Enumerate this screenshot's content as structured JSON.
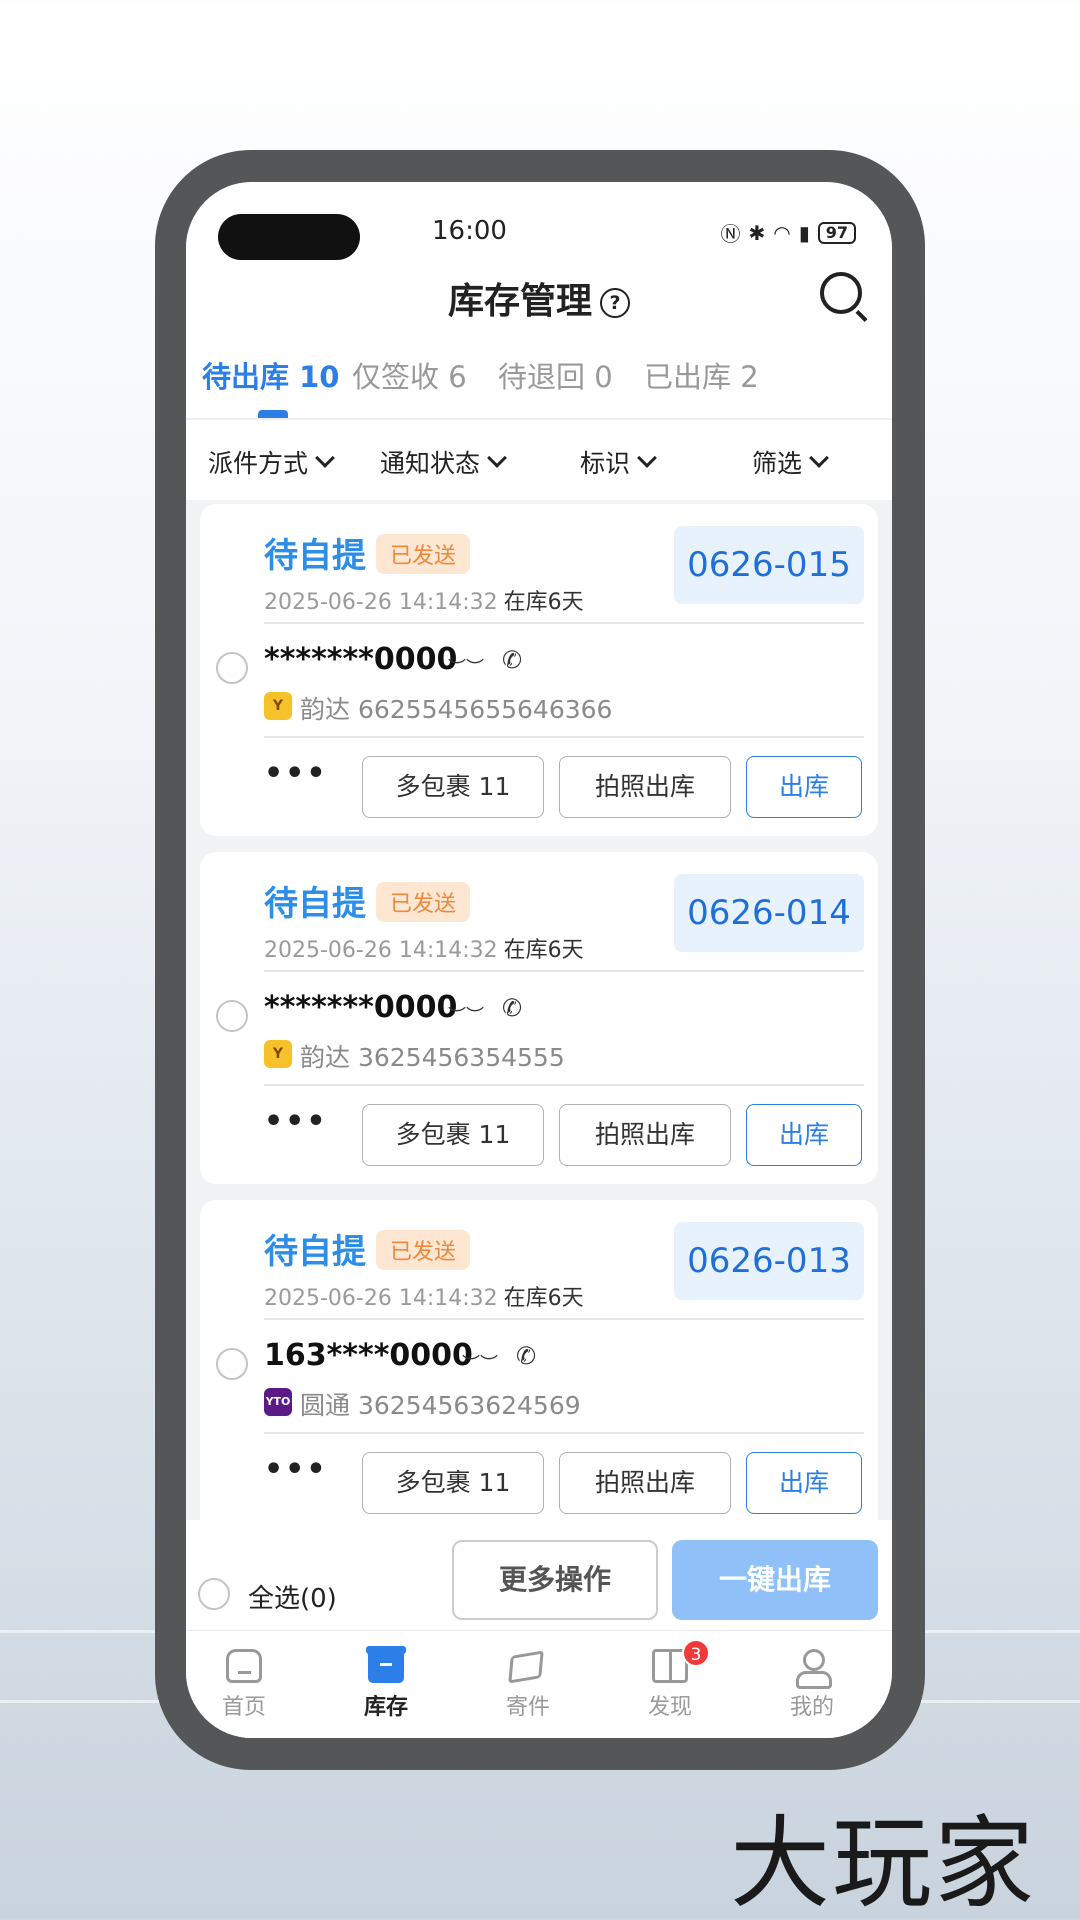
{
  "status_bar": {
    "time": "16:00",
    "battery": "97"
  },
  "header": {
    "title": "库存管理",
    "help_glyph": "?"
  },
  "tabs": [
    {
      "label": "待出库 10",
      "active": true
    },
    {
      "label": "仅签收 6",
      "active": false
    },
    {
      "label": "待退回 0",
      "active": false
    },
    {
      "label": "已出库 2",
      "active": false
    }
  ],
  "filters": [
    "派件方式",
    "通知状态",
    "标识",
    "筛选"
  ],
  "cards": [
    {
      "status": "待自提",
      "tag": "已发送",
      "time": "2025-06-26 14:14:32",
      "days": "在库6天",
      "code": "0626-015",
      "phone": "*******0000",
      "carrier": "韵达",
      "tracking": "6625545655646366",
      "more": "•••",
      "multi_btn": "多包裹 11",
      "photo_btn": "拍照出库",
      "out_btn": "出库"
    },
    {
      "status": "待自提",
      "tag": "已发送",
      "time": "2025-06-26 14:14:32",
      "days": "在库6天",
      "code": "0626-014",
      "phone": "*******0000",
      "carrier": "韵达",
      "tracking": "3625456354555",
      "more": "•••",
      "multi_btn": "多包裹 11",
      "photo_btn": "拍照出库",
      "out_btn": "出库"
    },
    {
      "status": "待自提",
      "tag": "已发送",
      "time": "2025-06-26 14:14:32",
      "days": "在库6天",
      "code": "0626-013",
      "phone": "163****0000",
      "carrier": "圆通",
      "tracking": "36254563624569",
      "more": "•••",
      "multi_btn": "多包裹 11",
      "photo_btn": "拍照出库",
      "out_btn": "出库"
    }
  ],
  "action_bar": {
    "select_all": "全选(0)",
    "more_ops": "更多操作",
    "one_click": "一键出库"
  },
  "bottom_nav": [
    {
      "label": "首页",
      "icon": "home-icon"
    },
    {
      "label": "库存",
      "icon": "inventory-icon",
      "active": true
    },
    {
      "label": "寄件",
      "icon": "send-icon"
    },
    {
      "label": "发现",
      "icon": "gift-icon",
      "badge": "3"
    },
    {
      "label": "我的",
      "icon": "user-icon"
    }
  ],
  "watermark": "大玩家",
  "colors": {
    "accent": "#2c7fe6",
    "status_blue": "#2c8ee8",
    "tag_orange": "#f0883a",
    "button_disabled": "#8fc0f7"
  }
}
